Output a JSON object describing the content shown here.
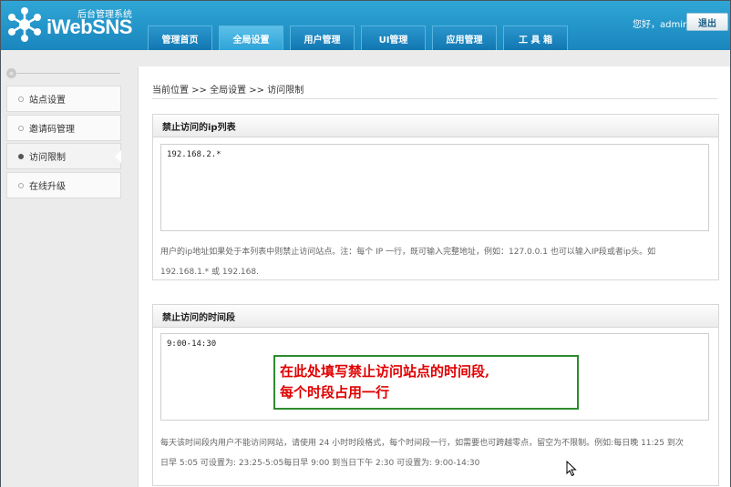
{
  "header": {
    "logo_subtitle": "后台管理系统",
    "logo_name": "iWebSNS",
    "greeting": "您好，admin",
    "logout_label": "退出",
    "tabs": [
      {
        "label": "管理首页"
      },
      {
        "label": "全局设置"
      },
      {
        "label": "用户管理"
      },
      {
        "label": "UI管理"
      },
      {
        "label": "应用管理"
      },
      {
        "label": "工 具 箱"
      }
    ],
    "active_tab": "全局设置",
    "accent": "#1a86bd"
  },
  "sidebar": {
    "collapse_label": "«",
    "items": [
      {
        "label": "站点设置"
      },
      {
        "label": "邀请码管理"
      },
      {
        "label": "访问限制"
      },
      {
        "label": "在线升级"
      }
    ],
    "active_item": "访问限制"
  },
  "main": {
    "breadcrumb": "当前位置 >> 全局设置 >> 访问限制",
    "ip_panel": {
      "title": "禁止访问的ip列表",
      "value": "192.168.2.*",
      "help_line1": "用户的ip地址如果处于本列表中则禁止访问站点。注：每个 IP 一行，既可输入完整地址，例如：127.0.0.1 也可以输入IP段或者ip头。如",
      "help_line2": "192.168.1.* 或 192.168."
    },
    "time_panel": {
      "title": "禁止访问的时间段",
      "value": "9:00-14:30",
      "help_line1": "每天该时间段内用户不能访问网站，请使用 24 小时时段格式，每个时间段一行，如需要也可跨越零点，留空为不限制。例如:每日晚 11:25 到次",
      "help_line2": "日早 5:05 可设置为: 23:25-5:05每日早 9:00 到当日下午 2:30 可设置为: 9:00-14:30"
    },
    "callout": {
      "line1": "在此处填写禁止访问站点的时间段,",
      "line2": "每个时段占用一行",
      "text_color": "#e00000",
      "border_color": "#2e8b2e"
    }
  }
}
